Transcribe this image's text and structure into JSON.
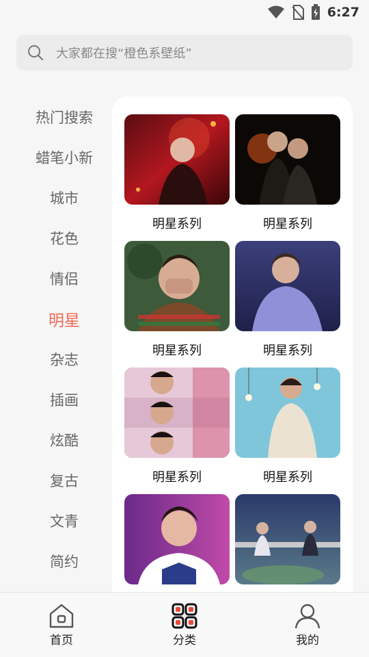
{
  "status_bar": {
    "time": "6:27",
    "icons": [
      "wifi-icon",
      "no-sim-icon",
      "battery-charging-icon"
    ]
  },
  "search": {
    "placeholder": "大家都在搜“橙色系壁纸”",
    "icon": "search-icon"
  },
  "sidebar": {
    "active_color": "#f06a55",
    "items": [
      {
        "label": "热门搜索"
      },
      {
        "label": "蜡笔小新"
      },
      {
        "label": "城市"
      },
      {
        "label": "花色"
      },
      {
        "label": "情侣"
      },
      {
        "label": "明星",
        "active": true
      },
      {
        "label": "杂志"
      },
      {
        "label": "插画"
      },
      {
        "label": "炫酷"
      },
      {
        "label": "复古"
      },
      {
        "label": "文青"
      },
      {
        "label": "简约"
      }
    ]
  },
  "content": {
    "cards": [
      {
        "caption": "明星系列"
      },
      {
        "caption": "明星系列"
      },
      {
        "caption": "明星系列"
      },
      {
        "caption": "明星系列"
      },
      {
        "caption": "明星系列"
      },
      {
        "caption": "明星系列"
      },
      {
        "caption": "",
        "image": "celebrity-photo"
      },
      {
        "caption": "",
        "image": "celebrity-photo"
      }
    ]
  },
  "bottom_nav": {
    "items": [
      {
        "label": "首页",
        "icon": "home-icon"
      },
      {
        "label": "分类",
        "icon": "category-icon",
        "active": true
      },
      {
        "label": "我的",
        "icon": "profile-icon"
      }
    ]
  }
}
